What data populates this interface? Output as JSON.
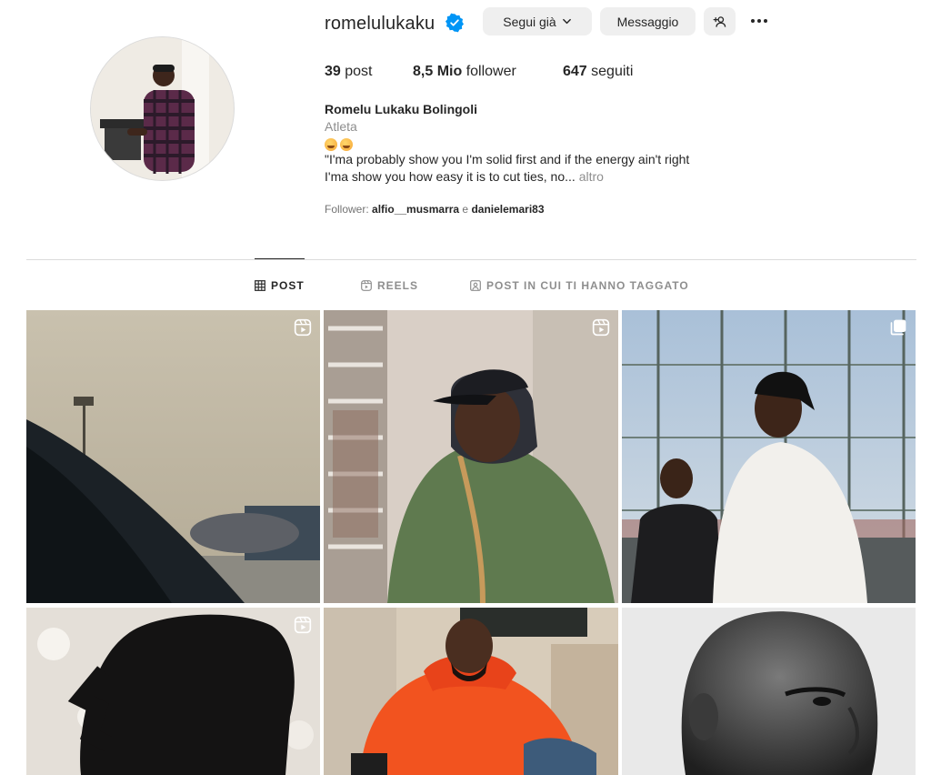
{
  "profile": {
    "username": "romelulukaku",
    "verified": true,
    "follow_button_label": "Segui già",
    "message_button_label": "Messaggio",
    "add_user_icon": "person-plus-icon",
    "more_icon": "ellipsis-icon",
    "stats": {
      "posts_count": "39",
      "posts_label": "post",
      "followers_count": "8,5 Mio",
      "followers_label": "follower",
      "following_count": "647",
      "following_label": "seguiti"
    },
    "full_name": "Romelu Lukaku Bolingoli",
    "category": "Atleta",
    "bio_line1": "\"I'ma probably show you I'm solid first and if the energy ain't right",
    "bio_line2": "I'ma show you how easy it is to cut ties, no...",
    "bio_more": "altro",
    "followed_by_prefix": "Follower:",
    "followed_by_user1": "alfio__musmarra",
    "followed_by_join": "e",
    "followed_by_user2": "danielemari83"
  },
  "tabs": [
    {
      "label": "POST",
      "icon": "grid-icon",
      "active": true
    },
    {
      "label": "REELS",
      "icon": "reels-icon",
      "active": false
    },
    {
      "label": "POST IN CUI TI HANNO TAGGATO",
      "icon": "tagged-icon",
      "active": false
    }
  ],
  "grid": [
    {
      "type": "reel",
      "icon": "reel-badge-icon"
    },
    {
      "type": "reel",
      "icon": "reel-badge-icon"
    },
    {
      "type": "carousel",
      "icon": "carousel-badge-icon"
    },
    {
      "type": "reel",
      "icon": "reel-badge-icon"
    },
    {
      "type": "photo"
    },
    {
      "type": "photo"
    }
  ],
  "colors": {
    "verified_blue": "#0095f6",
    "button_bg": "#efefef",
    "text_primary": "#262626",
    "text_secondary": "#8e8e8e",
    "divider": "#dbdbdb"
  }
}
